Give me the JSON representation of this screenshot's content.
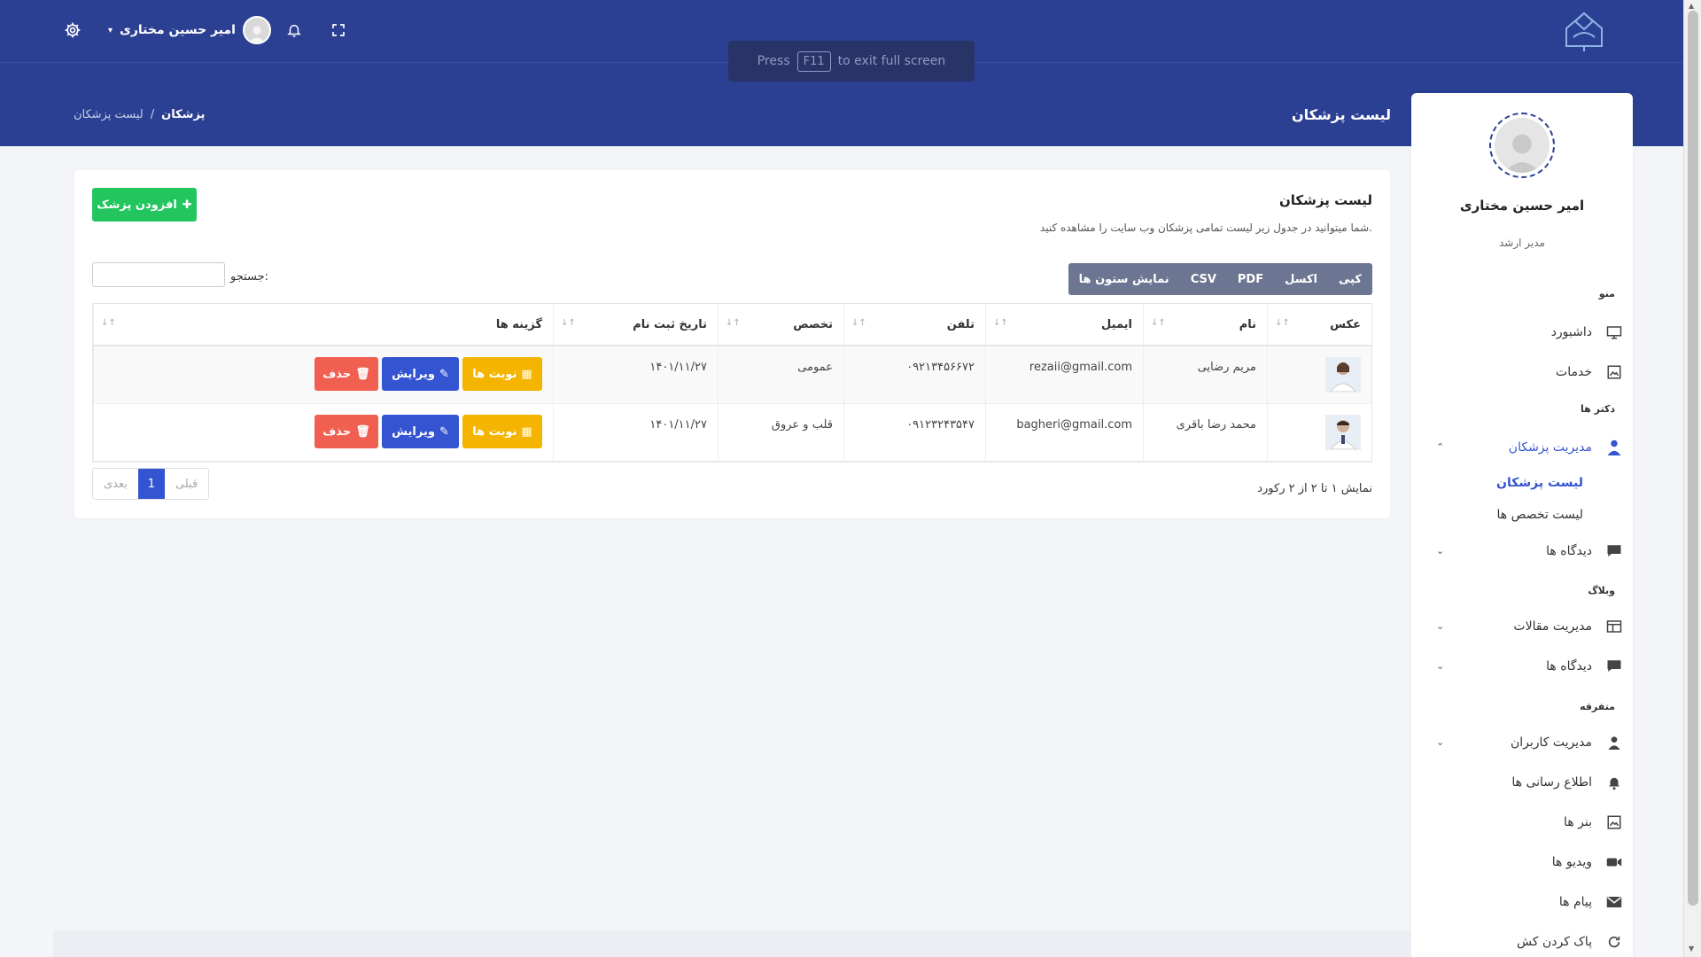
{
  "header": {
    "user_name": "امیر حسین مختاری",
    "f11_press": "Press",
    "f11_key": "F11",
    "f11_suffix": "to exit full screen"
  },
  "page": {
    "title": "لیست پزشکان",
    "breadcrumb": [
      "پزشکان",
      "لیست پزشکان"
    ]
  },
  "sidebar": {
    "user_name": "امیر حسین مختاری",
    "role": "مدیر ارشد",
    "sections": {
      "menu": "منو",
      "doctors": "دکتر ها",
      "blog": "وبلاگ",
      "misc": "متفرقه"
    },
    "items": {
      "dashboard": "داشبورد",
      "services": "خدمات",
      "doctor_management": "مدیریت پزشکان",
      "doctor_list": "لیست پزشکان",
      "specialty_list": "لیست تخصص ها",
      "reviews": "دیدگاه ها",
      "articles": "مدیریت مقالات",
      "blog_reviews": "دیدگاه ها",
      "users": "مدیریت کاربران",
      "notifications": "اطلاع رسانی ها",
      "banners": "بنر ها",
      "videos": "ویدیو ها",
      "messages": "پیام ها",
      "clear_cache": "پاک کردن کش"
    }
  },
  "card": {
    "title": "لیست پزشکان",
    "subtitle": "شما میتوانید در جدول زیر لیست تمامی پزشکان وب سایت را مشاهده کنید.",
    "add_button": "افزودن پزشک",
    "exports": [
      "کپی",
      "اکسل",
      "PDF",
      "CSV",
      "نمایش ستون ها"
    ],
    "search_label": "جستجو:"
  },
  "table": {
    "columns": [
      "عکس",
      "نام",
      "ایمیل",
      "تلفن",
      "تخصص",
      "تاریخ ثبت نام",
      "گزینه ها"
    ],
    "rows": [
      {
        "name": "مریم رضایی",
        "email": "rezaii@gmail.com",
        "phone": "۰۹۲۱۳۴۵۶۶۷۲",
        "specialty": "عمومی",
        "date": "۱۴۰۱/۱۱/۲۷"
      },
      {
        "name": "محمد رضا باقری",
        "email": "bagheri@gmail.com",
        "phone": "۰۹۱۲۳۲۴۳۵۴۷",
        "specialty": "قلب و عروق",
        "date": "۱۴۰۱/۱۱/۲۷"
      }
    ],
    "actions": {
      "appointments": "نوبت ها",
      "edit": "ویرایش",
      "delete": "حذف"
    }
  },
  "pagination": {
    "info": "نمایش ۱ تا ۲ از ۲ رکورد",
    "prev": "قبلی",
    "current": "1",
    "next": "بعدی"
  },
  "colors": {
    "header_bg": "#2b4092",
    "primary": "#3454d1",
    "success": "#22c55e",
    "warning": "#f4b400",
    "danger": "#f05f4f"
  }
}
